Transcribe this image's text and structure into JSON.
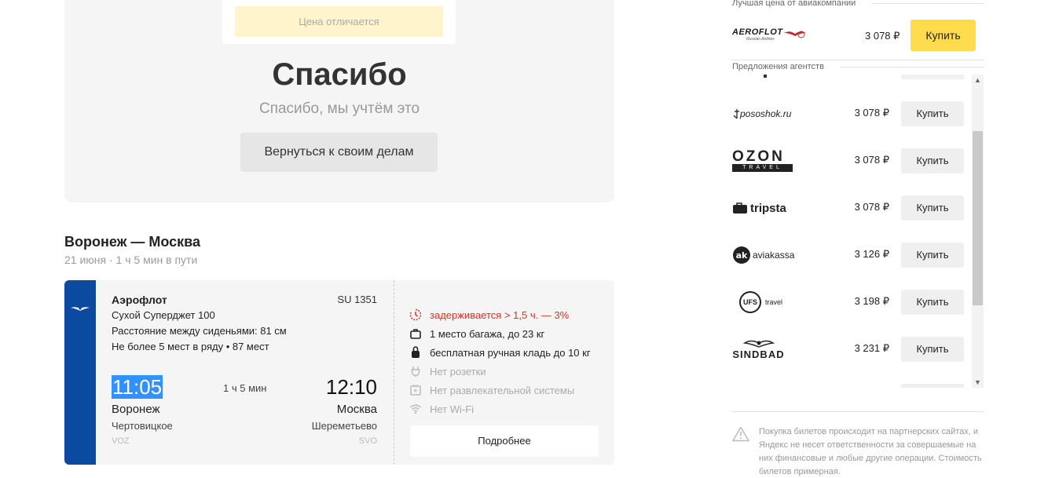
{
  "feedback": {
    "price_differs": "Цена отличается",
    "title": "Спасибо",
    "subtitle": "Спасибо, мы учтём это",
    "back_button": "Вернуться к своим делам"
  },
  "route": {
    "title": "Воронеж — Москва",
    "subtitle": "21 июня · 1 ч 5 мин в пути"
  },
  "flight": {
    "airline": "Аэрофлот",
    "flight_number": "SU 1351",
    "aircraft": "Сухой Суперджет 100",
    "seat_pitch": "Расстояние между сиденьями: 81 см",
    "seats_row": "Не более 5 мест в ряду • 87 мест",
    "departure": {
      "time": "11:05",
      "city": "Воронеж",
      "airport": "Чертовицкое",
      "code": "VOZ"
    },
    "duration": "1 ч 5 мин",
    "arrival": {
      "time": "12:10",
      "city": "Москва",
      "airport": "Шереметьево",
      "code": "SVO"
    },
    "amenities": [
      {
        "icon": "clock-alert-icon",
        "text": "задерживается > 1,5 ч. — 3%",
        "state": "warn"
      },
      {
        "icon": "baggage-icon",
        "text": "1 место багажа, до 23 кг",
        "state": "normal"
      },
      {
        "icon": "carry-on-icon",
        "text": "бесплатная ручная кладь до 10 кг",
        "state": "normal"
      },
      {
        "icon": "power-socket-icon",
        "text": "Нет розетки",
        "state": "muted"
      },
      {
        "icon": "entertainment-icon",
        "text": "Нет развлекательной системы",
        "state": "muted"
      },
      {
        "icon": "wifi-icon",
        "text": "Нет Wi-Fi",
        "state": "muted"
      }
    ],
    "details_button": "Подробнее"
  },
  "offers": {
    "best_label": "Лучшая цена от авиакомпании",
    "best": {
      "logo_text": "AEROFLOT",
      "logo_sub": "Russian Airlines",
      "price": "3 078 ₽",
      "buy": "Купить"
    },
    "agencies_label": "Предложения агентств",
    "agencies": [
      {
        "name": "pososhok.ru",
        "logo": "pososhok-logo",
        "price": "3 078 ₽",
        "buy": "Купить"
      },
      {
        "name": "OZON",
        "sub": "TRAVEL",
        "logo": "ozon-travel-logo",
        "price": "3 078 ₽",
        "buy": "Купить"
      },
      {
        "name": "tripsta",
        "logo": "tripsta-logo",
        "price": "3 078 ₽",
        "buy": "Купить"
      },
      {
        "name": "aviakassa",
        "logo": "aviakassa-logo",
        "price": "3 126 ₽",
        "buy": "Купить"
      },
      {
        "name": "travel",
        "badge": "UFS",
        "logo": "ufs-travel-logo",
        "price": "3 198 ₽",
        "buy": "Купить"
      },
      {
        "name": "SINDBAD",
        "logo": "sindbad-logo",
        "price": "3 231 ₽",
        "buy": "Купить"
      }
    ],
    "disclaimer": "Покупка билетов происходит на партнерских сайтах, и Яндекс не несет ответственности за совершаемые на них финансовые и любые другие операции. Стоимость билетов примерная."
  },
  "colors": {
    "accent_yellow": "#ffdb4d",
    "aeroflot_blue": "#0a4aa0",
    "warn_red": "#d9322b",
    "selection_blue": "#3390ff"
  }
}
